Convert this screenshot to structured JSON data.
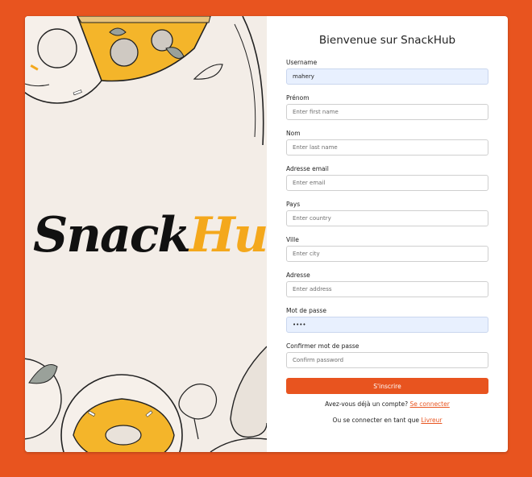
{
  "brand": {
    "part1": "Snack",
    "part2": "Hub"
  },
  "form": {
    "title": "Bienvenue sur SnackHub",
    "fields": [
      {
        "label": "Username",
        "placeholder": "",
        "value": "mahery"
      },
      {
        "label": "Prénom",
        "placeholder": "Enter first name",
        "value": ""
      },
      {
        "label": "Nom",
        "placeholder": "Enter last name",
        "value": ""
      },
      {
        "label": "Adresse email",
        "placeholder": "Enter email",
        "value": ""
      },
      {
        "label": "Pays",
        "placeholder": "Enter country",
        "value": ""
      },
      {
        "label": "Ville",
        "placeholder": "Enter city",
        "value": ""
      },
      {
        "label": "Adresse",
        "placeholder": "Enter address",
        "value": ""
      },
      {
        "label": "Mot de passe",
        "placeholder": "",
        "value": "1234"
      },
      {
        "label": "Confirmer mot de passe",
        "placeholder": "Confirm password",
        "value": ""
      }
    ],
    "submit_label": "S'inscrire"
  },
  "footer": {
    "login_prompt": "Avez-vous déjà un compte?",
    "login_link": "Se connecter",
    "driver_prompt": "Ou se connecter en tant que",
    "driver_link": "Livreur"
  },
  "colors": {
    "accent": "#e8541f",
    "panel": "#f3ede7",
    "brand_yellow": "#f4a81c",
    "autofill": "#e8f0fe"
  },
  "decorations": [
    "pizza-slice-illustration",
    "donut-illustration",
    "leaf-illustration",
    "broccoli-illustration"
  ]
}
